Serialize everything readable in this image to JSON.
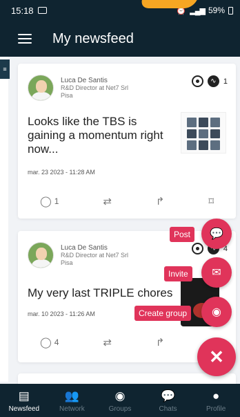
{
  "status_bar": {
    "time": "15:18",
    "battery": "59%"
  },
  "header": {
    "title": "My newsfeed"
  },
  "posts": [
    {
      "author": "Luca De Santis",
      "role": "R&D Director at Net7 Srl",
      "location": "Pisa",
      "text": "Looks like the TBS is gaining a momentum right now...",
      "date": "mar. 23 2023 - 11:28 AM",
      "badge_count": "1",
      "comments": "1"
    },
    {
      "author": "Luca De Santis",
      "role": "R&D Director at Net7 Srl",
      "location": "Pisa",
      "text": "My very last TRIPLE chores",
      "date": "mar. 10 2023 - 11:26 AM",
      "badge_count": "4",
      "comments": "4"
    }
  ],
  "fab_menu": {
    "post_label": "Post",
    "invite_label": "Invite",
    "create_group_label": "Create group"
  },
  "bottom_nav": {
    "items": [
      {
        "label": "Newsfeed",
        "icon": "newsfeed-icon"
      },
      {
        "label": "Network",
        "icon": "network-icon"
      },
      {
        "label": "Groups",
        "icon": "groups-icon"
      },
      {
        "label": "Chats",
        "icon": "chats-icon"
      },
      {
        "label": "Profile",
        "icon": "profile-icon"
      }
    ]
  },
  "colors": {
    "header_bg": "#0f2430",
    "accent": "#e0345a"
  }
}
